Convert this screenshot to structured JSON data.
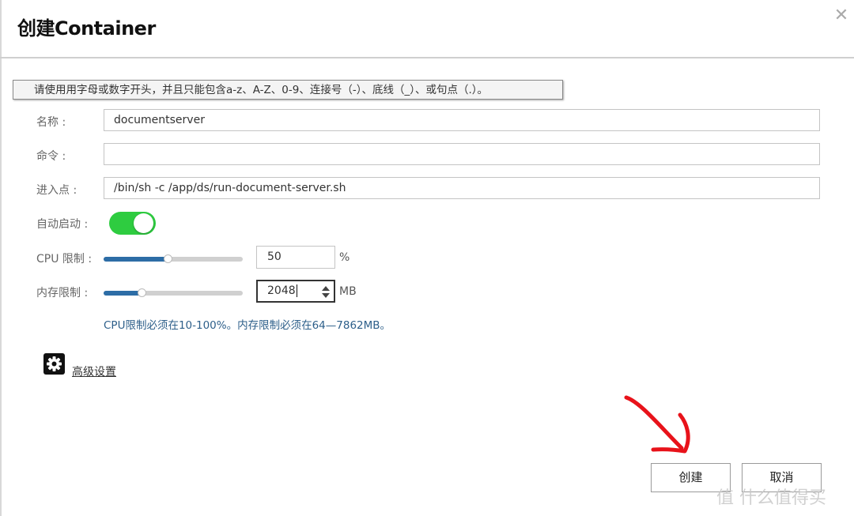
{
  "dialog": {
    "title": "创建Container",
    "close_glyph": "✕"
  },
  "tooltip": {
    "text": "请使用用字母或数字开头，并且只能包含a-z、A-Z、0-9、连接号（-）、底线（_）、或句点（.）。"
  },
  "form": {
    "name": {
      "label": "名称 :",
      "value": "documentserver"
    },
    "command": {
      "label": "命令 :",
      "value": ""
    },
    "entrypoint": {
      "label": "进入点 :",
      "value": "/bin/sh -c /app/ds/run-document-server.sh"
    },
    "autostart": {
      "label": "自动启动 :",
      "enabled": true,
      "color": "#2ecc40"
    },
    "cpu": {
      "label": "CPU 限制 :",
      "value": "50",
      "unit": "%",
      "slider_fraction": 0.46
    },
    "memory": {
      "label": "内存限制 :",
      "value": "2048",
      "unit": "MB",
      "slider_fraction": 0.27
    },
    "hint": "CPU限制必须在10-100%。内存限制必须在64—7862MB。"
  },
  "advanced": {
    "icon": "gear-icon",
    "label": "高级设置"
  },
  "buttons": {
    "create": "创建",
    "cancel": "取消"
  },
  "colors": {
    "accent": "#2d6da6",
    "hint": "#2d5f8a",
    "annotation_arrow": "#e8121a"
  },
  "watermark": {
    "text": "值 什么值得买"
  }
}
